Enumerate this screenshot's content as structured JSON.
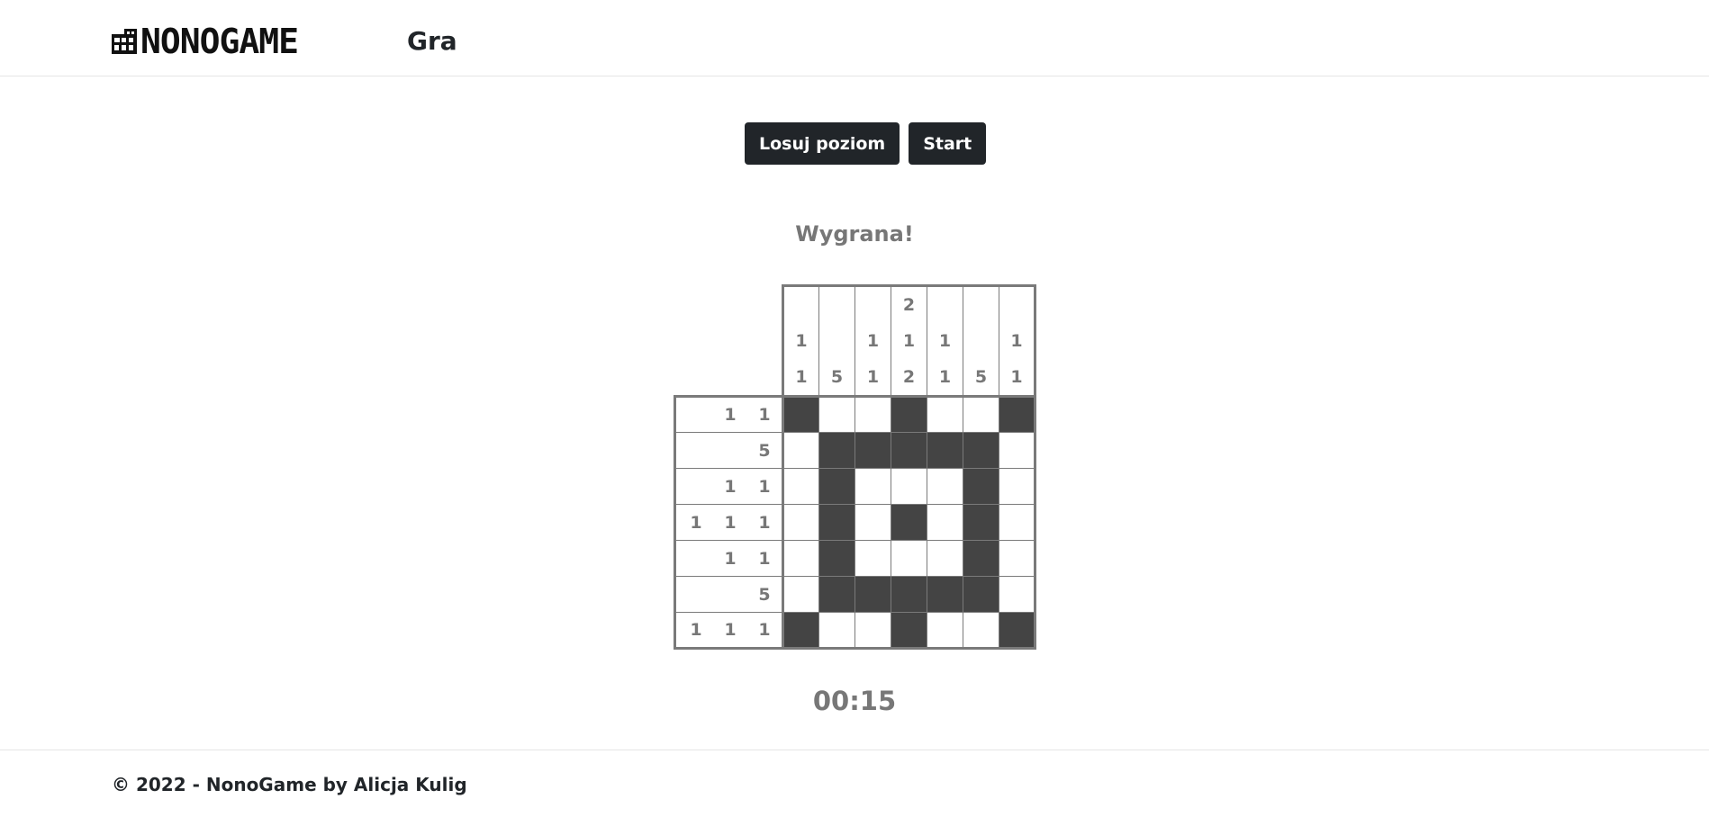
{
  "nav": {
    "brand": "NONOGAME",
    "link_game": "Gra"
  },
  "actions": {
    "random_label": "Losuj poziom",
    "start_label": "Start"
  },
  "status": "Wygrana!",
  "board": {
    "col_clues": [
      [
        "1",
        "1"
      ],
      [
        "5"
      ],
      [
        "1",
        "1"
      ],
      [
        "2",
        "1",
        "2"
      ],
      [
        "1",
        "1"
      ],
      [
        "5"
      ],
      [
        "1",
        "1"
      ]
    ],
    "row_clues": [
      [
        "1",
        "1"
      ],
      [
        "5"
      ],
      [
        "1",
        "1"
      ],
      [
        "1",
        "1",
        "1"
      ],
      [
        "1",
        "1"
      ],
      [
        "5"
      ],
      [
        "1",
        "1",
        "1"
      ]
    ],
    "cells": [
      [
        1,
        0,
        0,
        1,
        0,
        0,
        1
      ],
      [
        0,
        1,
        1,
        1,
        1,
        1,
        0
      ],
      [
        0,
        1,
        0,
        0,
        0,
        1,
        0
      ],
      [
        0,
        1,
        0,
        1,
        0,
        1,
        0
      ],
      [
        0,
        1,
        0,
        0,
        0,
        1,
        0
      ],
      [
        0,
        1,
        1,
        1,
        1,
        1,
        0
      ],
      [
        1,
        0,
        0,
        1,
        0,
        0,
        1
      ]
    ]
  },
  "timer": "00:15",
  "footer": {
    "copyright": "© 2022 - NonoGame by Alicja Kulig"
  }
}
